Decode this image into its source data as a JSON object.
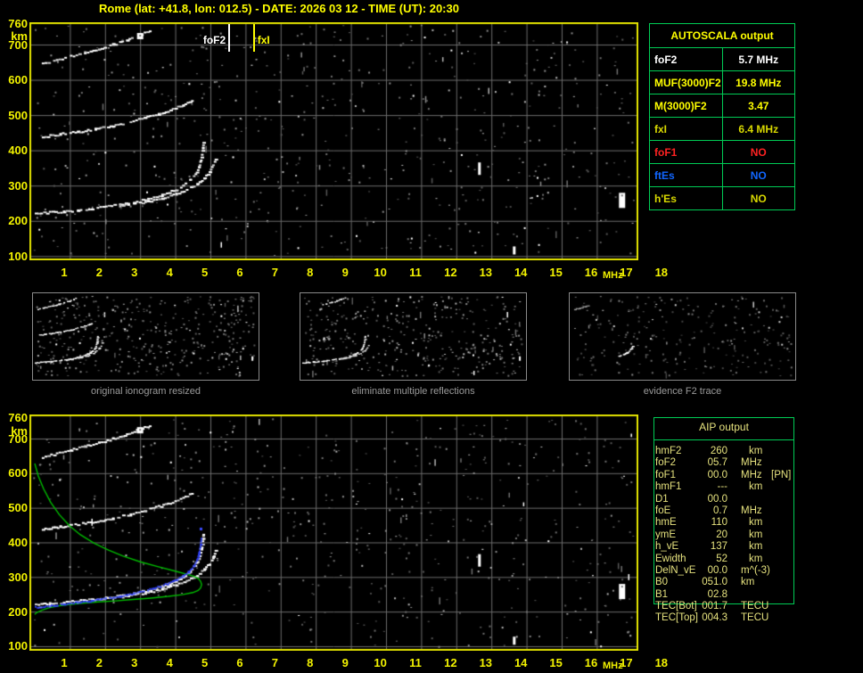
{
  "title": "Rome (lat: +41.8, lon: 012.5) - DATE: 2026 03 12 - TIME (UT): 20:30",
  "colors": {
    "background": "#000000",
    "title": "#ffff00",
    "plot_border": "#e0e000",
    "grid": "#6b6b6b",
    "axis_label": "#f2f200",
    "trace_white": "#ffffff",
    "profile_green": "#00bb00",
    "restored_blue": "#2b3cf0",
    "table_border": "#00cc55",
    "caption_gray": "#9b9b9b",
    "aip_text": "#e6e27e",
    "thumb_border": "#8a8a8a"
  },
  "axes": {
    "x_ticks": [
      1,
      2,
      3,
      4,
      5,
      6,
      7,
      8,
      9,
      10,
      11,
      12,
      13,
      14,
      15,
      16,
      17,
      18
    ],
    "x_unit": "MHz",
    "y_ticks": [
      760,
      700,
      600,
      500,
      400,
      300,
      200,
      100
    ],
    "y_unit": "km"
  },
  "markers": [
    {
      "label": "foF2",
      "mhz": 5.7,
      "color": "#ffffff",
      "label_side": "left"
    },
    {
      "label": "fxI",
      "mhz": 6.4,
      "color": "#ffff00",
      "label_side": "right"
    }
  ],
  "autoscala": {
    "header": "AUTOSCALA output",
    "rows": [
      {
        "param": "foF2",
        "value": "5.7 MHz",
        "color": "#ffffff"
      },
      {
        "param": "MUF(3000)F2",
        "value": "19.8 MHz",
        "color": "#ffff00"
      },
      {
        "param": "M(3000)F2",
        "value": "3.47",
        "color": "#ffff00"
      },
      {
        "param": "fxI",
        "value": "6.4 MHz",
        "color": "#d8d800"
      },
      {
        "param": "foF1",
        "value": "NO",
        "color": "#ff2222"
      },
      {
        "param": "ftEs",
        "value": "NO",
        "color": "#1166ff"
      },
      {
        "param": "h'Es",
        "value": "NO",
        "color": "#d8d800"
      }
    ]
  },
  "aip": {
    "header": "AIP output",
    "rows": [
      {
        "param": "hmF2",
        "value": "260",
        "unit": "km",
        "note": ""
      },
      {
        "param": "foF2",
        "value": "05.7",
        "unit": "MHz",
        "note": ""
      },
      {
        "param": "foF1",
        "value": "00.0",
        "unit": "MHz",
        "note": "[PN]"
      },
      {
        "param": "hmF1",
        "value": "---",
        "unit": "km",
        "note": ""
      },
      {
        "param": "D1",
        "value": "00.0",
        "unit": "",
        "note": ""
      },
      {
        "param": "foE",
        "value": "0.7",
        "unit": "MHz",
        "note": ""
      },
      {
        "param": "hmE",
        "value": "110",
        "unit": "km",
        "note": ""
      },
      {
        "param": "ymE",
        "value": "20",
        "unit": "km",
        "note": ""
      },
      {
        "param": "h_vE",
        "value": "137",
        "unit": "km",
        "note": ""
      },
      {
        "param": "Ewidth",
        "value": "52",
        "unit": "km",
        "note": ""
      },
      {
        "param": "DelN_vE",
        "value": "00.0",
        "unit": "m^(-3)",
        "note": ""
      },
      {
        "param": "B0",
        "value": "051.0",
        "unit": "km",
        "note": ""
      },
      {
        "param": "B1",
        "value": "02.8",
        "unit": "",
        "note": ""
      },
      {
        "param": "TEC[Bot]",
        "value": "001.7",
        "unit": "TECU",
        "note": ""
      },
      {
        "param": "TEC[Top]",
        "value": "004.3",
        "unit": "TECU",
        "note": ""
      }
    ]
  },
  "thumbnails": [
    {
      "caption": "original ionogram resized"
    },
    {
      "caption": "eliminate multiple reflections"
    },
    {
      "caption": "evidence F2 trace"
    }
  ],
  "chart_data": {
    "type": "scatter",
    "description": "Ionogram (virtual height km vs frequency MHz) with AUTOSCALA scaling; bottom panel adds restored trace (blue) and electron density profile (green)",
    "x_range": [
      1,
      18
    ],
    "x_unit": "MHz",
    "y_range": [
      100,
      760
    ],
    "y_unit": "km",
    "grid": true,
    "traces": {
      "F2_ordinary": [
        [
          1,
          220
        ],
        [
          1.4,
          223
        ],
        [
          1.8,
          226
        ],
        [
          2.2,
          230
        ],
        [
          2.6,
          234
        ],
        [
          3,
          239
        ],
        [
          3.4,
          245
        ],
        [
          3.8,
          252
        ],
        [
          4.2,
          261
        ],
        [
          4.6,
          272
        ],
        [
          5,
          288
        ],
        [
          5.2,
          299
        ],
        [
          5.4,
          314
        ],
        [
          5.55,
          331
        ],
        [
          5.65,
          352
        ],
        [
          5.72,
          378
        ],
        [
          5.76,
          408
        ],
        [
          5.78,
          432
        ]
      ],
      "F2_extraordinary": [
        [
          3.4,
          242
        ],
        [
          3.8,
          248
        ],
        [
          4.2,
          255
        ],
        [
          4.6,
          264
        ],
        [
          5,
          276
        ],
        [
          5.3,
          288
        ],
        [
          5.6,
          305
        ],
        [
          5.8,
          321
        ],
        [
          5.95,
          338
        ],
        [
          6.05,
          356
        ],
        [
          6.12,
          375
        ]
      ],
      "second_hop": [
        [
          1.2,
          438
        ],
        [
          1.7,
          445
        ],
        [
          2.2,
          452
        ],
        [
          2.7,
          460
        ],
        [
          3.2,
          469
        ],
        [
          3.7,
          480
        ],
        [
          4.1,
          491
        ],
        [
          4.5,
          503
        ],
        [
          4.9,
          516
        ],
        [
          5.2,
          528
        ],
        [
          5.45,
          541
        ]
      ],
      "third_hop": [
        [
          1.2,
          646
        ],
        [
          1.6,
          656
        ],
        [
          2.0,
          666
        ],
        [
          2.4,
          676
        ],
        [
          2.8,
          687
        ],
        [
          3.2,
          699
        ],
        [
          3.6,
          712
        ],
        [
          3.95,
          725
        ],
        [
          4.25,
          738
        ]
      ]
    },
    "restored_trace_blue": [
      [
        1,
        212
      ],
      [
        1.4,
        216
      ],
      [
        1.8,
        221
      ],
      [
        2.2,
        226
      ],
      [
        2.6,
        231
      ],
      [
        3,
        237
      ],
      [
        3.4,
        244
      ],
      [
        3.8,
        252
      ],
      [
        4.2,
        262
      ],
      [
        4.6,
        274
      ],
      [
        5,
        290
      ],
      [
        5.2,
        302
      ],
      [
        5.35,
        314
      ],
      [
        5.5,
        330
      ],
      [
        5.6,
        349
      ],
      [
        5.66,
        370
      ],
      [
        5.7,
        393
      ],
      [
        5.72,
        412
      ]
    ],
    "restored_isolated_point": [
      5.72,
      440
    ],
    "density_profile_green": [
      [
        1,
        628
      ],
      [
        1.1,
        592
      ],
      [
        1.25,
        555
      ],
      [
        1.45,
        516
      ],
      [
        1.7,
        480
      ],
      [
        2.0,
        447
      ],
      [
        2.3,
        422
      ],
      [
        2.7,
        397
      ],
      [
        3.1,
        378
      ],
      [
        3.5,
        361
      ],
      [
        4.0,
        344
      ],
      [
        4.5,
        330
      ],
      [
        5.0,
        317
      ],
      [
        5.3,
        309
      ],
      [
        5.5,
        303
      ],
      [
        5.65,
        296
      ],
      [
        5.72,
        288
      ],
      [
        5.75,
        278
      ],
      [
        5.72,
        268
      ],
      [
        5.65,
        261
      ],
      [
        5.5,
        255
      ],
      [
        5.2,
        249
      ],
      [
        4.8,
        244
      ],
      [
        4.3,
        239
      ],
      [
        3.8,
        235
      ],
      [
        3.3,
        231
      ],
      [
        2.8,
        228
      ],
      [
        2.4,
        225
      ],
      [
        2.0,
        221
      ],
      [
        1.7,
        217
      ],
      [
        1.4,
        211
      ],
      [
        1.2,
        204
      ],
      [
        1.05,
        197
      ],
      [
        1.0,
        192
      ]
    ],
    "bright_marks": [
      {
        "mhz": 13.66,
        "km": 348,
        "w": 3,
        "h": 14
      },
      {
        "mhz": 17.72,
        "km": 258,
        "w": 7,
        "h": 17
      },
      {
        "mhz": 14.65,
        "km": 116,
        "w": 3,
        "h": 9
      },
      {
        "mhz": 4.0,
        "km": 724,
        "w": 7,
        "h": 7
      }
    ],
    "scaled_values": {
      "foF2_MHz": 5.7,
      "fxI_MHz": 6.4,
      "hmF2_km": 260
    }
  }
}
